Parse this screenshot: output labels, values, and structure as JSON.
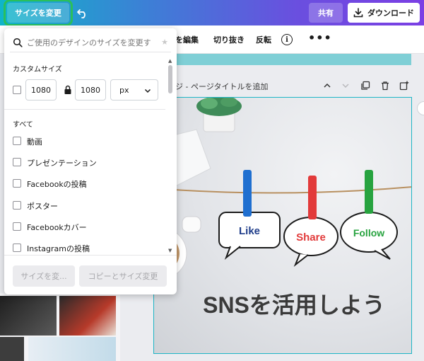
{
  "topbar": {
    "resize_label": "サイズを変更",
    "share_label": "共有",
    "download_label": "ダウンロード",
    "accent": "#2bbf5b"
  },
  "toolbar": {
    "edit_label": "を編集",
    "crop_label": "切り抜き",
    "flip_label": "反転",
    "info_label": "i",
    "more_label": "•••"
  },
  "canvas": {
    "page_title": "ジ - ページタイトルを追加",
    "pins": [
      {
        "text": "Like",
        "color": "#1f6fd0"
      },
      {
        "text": "Share",
        "color": "#e23a3a"
      },
      {
        "text": "Follow",
        "color": "#27a33f"
      }
    ],
    "headline": "SNSを活用しよう"
  },
  "resize_panel": {
    "search_placeholder": "ご使用のデザインのサイズを変更す",
    "custom_size_label": "カスタムサイズ",
    "width_value": "1080",
    "height_value": "1080",
    "unit_value": "px",
    "all_label": "すべて",
    "items": [
      {
        "label": "動画"
      },
      {
        "label": "プレゼンテーション"
      },
      {
        "label": "Facebookの投稿"
      },
      {
        "label": "ポスター"
      },
      {
        "label": "Facebookカバー"
      },
      {
        "label": "Instagramの投稿"
      }
    ],
    "resize_button_label": "サイズを変...",
    "copy_resize_button_label": "コピーとサイズ変更"
  }
}
